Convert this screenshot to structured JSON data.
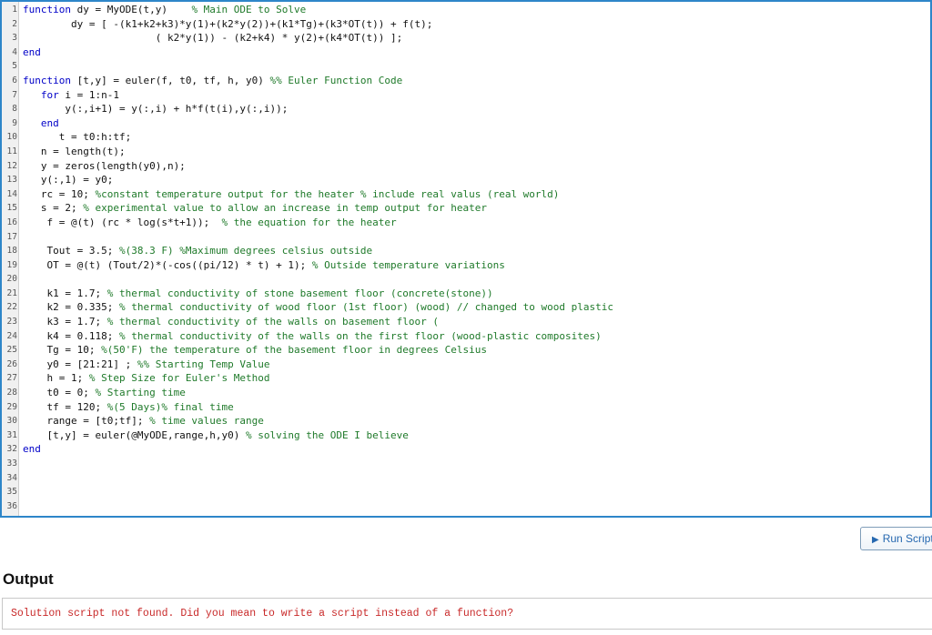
{
  "editor": {
    "lines": [
      {
        "n": "1",
        "segs": [
          {
            "c": "kw",
            "t": "function"
          },
          {
            "c": "",
            "t": " dy = MyODE(t,y)    "
          },
          {
            "c": "cm",
            "t": "% Main ODE to Solve"
          }
        ]
      },
      {
        "n": "2",
        "segs": [
          {
            "c": "",
            "t": "        dy = [ -(k1+k2+k3)*y(1)+(k2*y(2))+(k1*Tg)+(k3*OT(t)) + f(t);"
          }
        ]
      },
      {
        "n": "3",
        "segs": [
          {
            "c": "",
            "t": "                      ( k2*y(1)) - (k2+k4) * y(2)+(k4*OT(t)) ];"
          }
        ]
      },
      {
        "n": "4",
        "segs": [
          {
            "c": "kw",
            "t": "end"
          }
        ]
      },
      {
        "n": "5",
        "segs": []
      },
      {
        "n": "6",
        "segs": [
          {
            "c": "kw",
            "t": "function"
          },
          {
            "c": "",
            "t": " [t,y] = euler(f, t0, tf, h, y0) "
          },
          {
            "c": "cm",
            "t": "%% Euler Function Code"
          }
        ]
      },
      {
        "n": "7",
        "segs": [
          {
            "c": "",
            "t": "   "
          },
          {
            "c": "kw",
            "t": "for"
          },
          {
            "c": "",
            "t": " i = 1:n-1"
          }
        ]
      },
      {
        "n": "8",
        "segs": [
          {
            "c": "",
            "t": "       y(:,i+1) = y(:,i) + h*f(t(i),y(:,i));"
          }
        ]
      },
      {
        "n": "9",
        "segs": [
          {
            "c": "",
            "t": "   "
          },
          {
            "c": "kw",
            "t": "end"
          }
        ]
      },
      {
        "n": "10",
        "segs": [
          {
            "c": "",
            "t": "      t = t0:h:tf;"
          }
        ]
      },
      {
        "n": "11",
        "segs": [
          {
            "c": "",
            "t": "   n = length(t);"
          }
        ]
      },
      {
        "n": "12",
        "segs": [
          {
            "c": "",
            "t": "   y = zeros(length(y0),n);"
          }
        ]
      },
      {
        "n": "13",
        "segs": [
          {
            "c": "",
            "t": "   y(:,1) = y0;"
          }
        ]
      },
      {
        "n": "14",
        "segs": [
          {
            "c": "",
            "t": "   rc = 10; "
          },
          {
            "c": "cm",
            "t": "%constant temperature output for the heater % include real valus (real world)"
          }
        ]
      },
      {
        "n": "15",
        "segs": [
          {
            "c": "",
            "t": "   s = 2; "
          },
          {
            "c": "cm",
            "t": "% experimental value to allow an increase in temp output for heater"
          }
        ]
      },
      {
        "n": "16",
        "segs": [
          {
            "c": "",
            "t": "    f = @(t) (rc * log(s*t+1));  "
          },
          {
            "c": "cm",
            "t": "% the equation for the heater"
          }
        ]
      },
      {
        "n": "17",
        "segs": []
      },
      {
        "n": "18",
        "segs": [
          {
            "c": "",
            "t": "    Tout = 3.5; "
          },
          {
            "c": "cm",
            "t": "%(38.3 F) %Maximum degrees celsius outside"
          }
        ]
      },
      {
        "n": "19",
        "segs": [
          {
            "c": "",
            "t": "    OT = @(t) (Tout/2)*(-cos((pi/12) * t) + 1); "
          },
          {
            "c": "cm",
            "t": "% Outside temperature variations"
          }
        ]
      },
      {
        "n": "20",
        "segs": []
      },
      {
        "n": "21",
        "segs": [
          {
            "c": "",
            "t": "    k1 = 1.7; "
          },
          {
            "c": "cm",
            "t": "% thermal conductivity of stone basement floor (concrete(stone))"
          }
        ]
      },
      {
        "n": "22",
        "segs": [
          {
            "c": "",
            "t": "    k2 = 0.335; "
          },
          {
            "c": "cm",
            "t": "% thermal conductivity of wood floor (1st floor) (wood) // changed to wood plastic"
          }
        ]
      },
      {
        "n": "23",
        "segs": [
          {
            "c": "",
            "t": "    k3 = 1.7; "
          },
          {
            "c": "cm",
            "t": "% thermal conductivity of the walls on basement floor ("
          }
        ]
      },
      {
        "n": "24",
        "segs": [
          {
            "c": "",
            "t": "    k4 = 0.118; "
          },
          {
            "c": "cm",
            "t": "% thermal conductivity of the walls on the first floor (wood-plastic composites)"
          }
        ]
      },
      {
        "n": "25",
        "segs": [
          {
            "c": "",
            "t": "    Tg = 10; "
          },
          {
            "c": "cm",
            "t": "%(50'F) the temperature of the basement floor in degrees Celsius"
          }
        ]
      },
      {
        "n": "26",
        "segs": [
          {
            "c": "",
            "t": "    y0 = [21:21] ; "
          },
          {
            "c": "cm",
            "t": "%% Starting Temp Value"
          }
        ]
      },
      {
        "n": "27",
        "segs": [
          {
            "c": "",
            "t": "    h = 1; "
          },
          {
            "c": "cm",
            "t": "% Step Size for Euler's Method"
          }
        ]
      },
      {
        "n": "28",
        "segs": [
          {
            "c": "",
            "t": "    t0 = 0; "
          },
          {
            "c": "cm",
            "t": "% Starting time"
          }
        ]
      },
      {
        "n": "29",
        "segs": [
          {
            "c": "",
            "t": "    tf = 120; "
          },
          {
            "c": "cm",
            "t": "%(5 Days)% final time"
          }
        ]
      },
      {
        "n": "30",
        "segs": [
          {
            "c": "",
            "t": "    range = [t0;tf]; "
          },
          {
            "c": "cm",
            "t": "% time values range"
          }
        ]
      },
      {
        "n": "31",
        "segs": [
          {
            "c": "",
            "t": "    [t,y] = euler(@MyODE,range,h,y0) "
          },
          {
            "c": "cm",
            "t": "% solving the ODE I believe"
          }
        ]
      },
      {
        "n": "32",
        "segs": [
          {
            "c": "kw",
            "t": "end"
          }
        ]
      },
      {
        "n": "33",
        "segs": []
      },
      {
        "n": "34",
        "segs": []
      },
      {
        "n": "35",
        "segs": []
      },
      {
        "n": "36",
        "segs": []
      }
    ]
  },
  "toolbar": {
    "run_label": "Run Script",
    "run_icon": "play-icon"
  },
  "output": {
    "heading": "Output",
    "message": "Solution script not found. Did you mean to write a script instead of a function?"
  },
  "colors": {
    "editor_border": "#2e86c9",
    "keyword": "#0000c8",
    "comment": "#1f7a2a",
    "error_text": "#c82828",
    "button_text": "#2668b0"
  }
}
